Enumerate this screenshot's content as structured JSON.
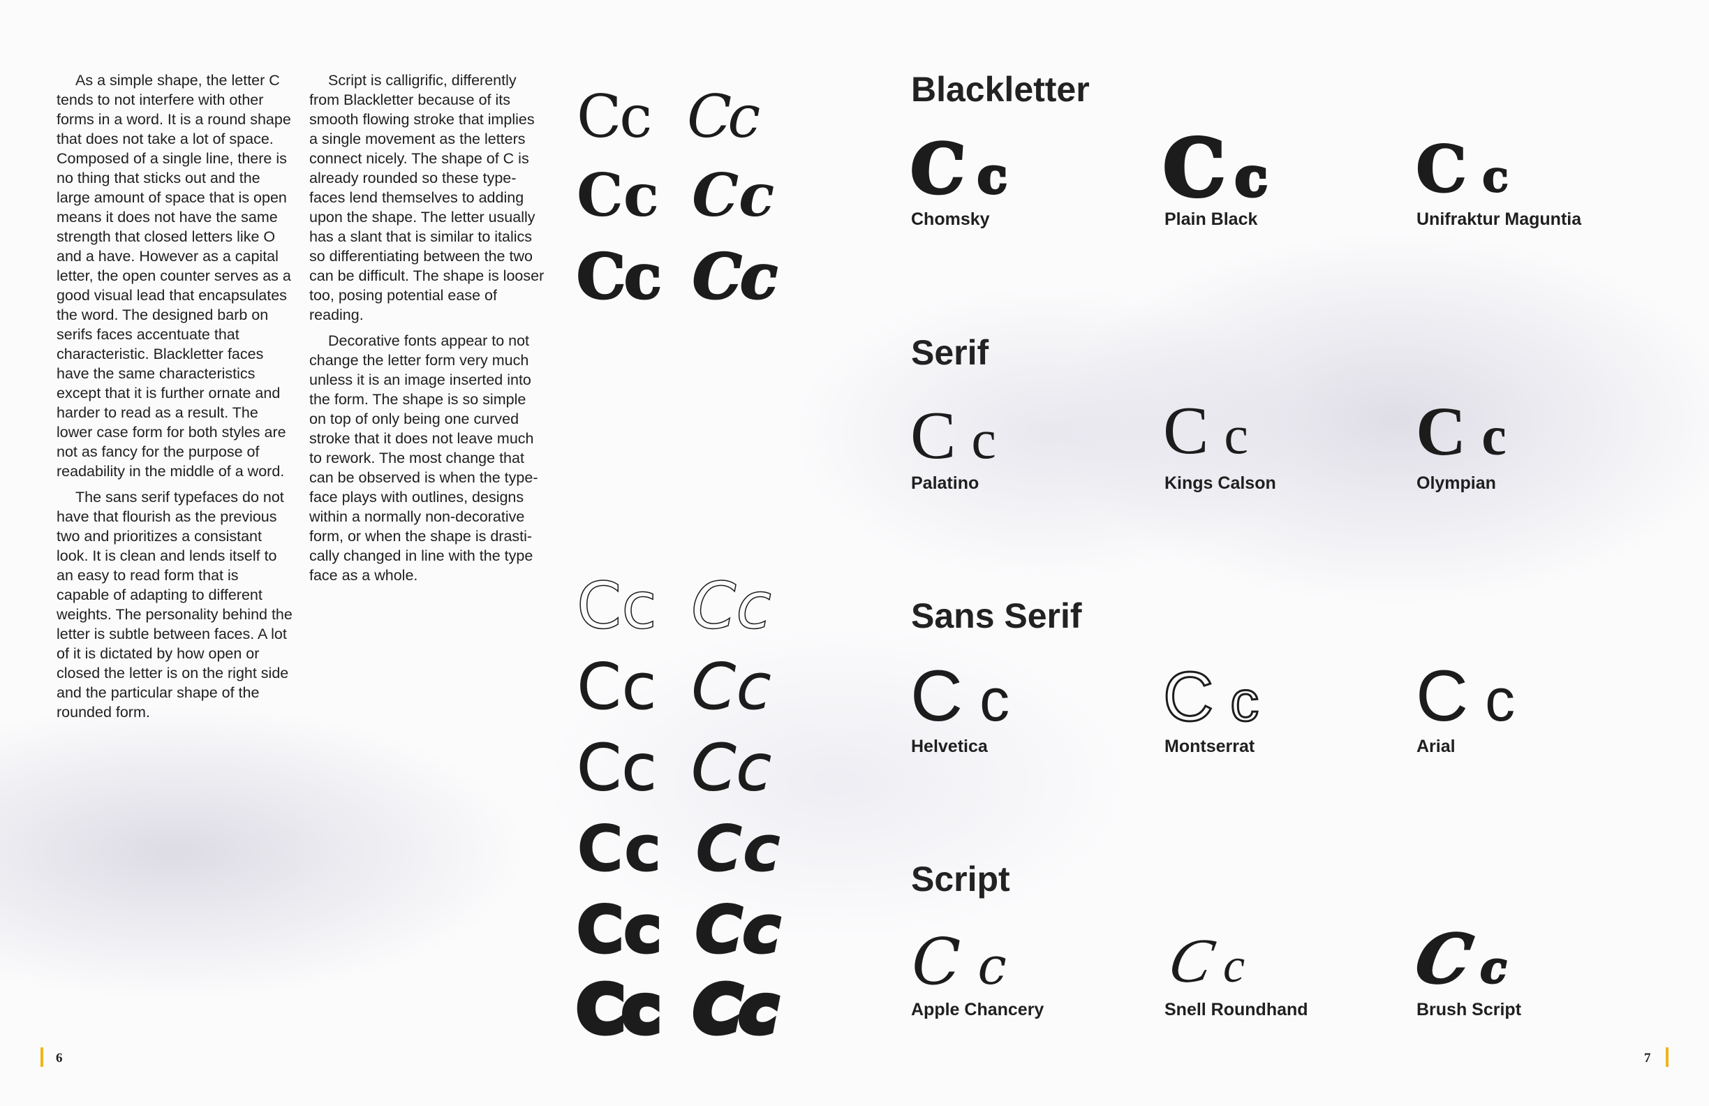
{
  "column_left": {
    "paragraphs": [
      "As a simple shape, the letter C tends to not interfere with other forms in a word. It is a round shape that  does not take a lot of space. Composed of a single line, there is no thing that sticks out and the large amount of space that is open means it does not have the same strength that closed letters like O and a have. However as a capital letter, the open counter serves as a good visual lead that encapsulates the word. The designed barb on serifs faces accentuate that characteristic. Blackletter faces have the same characteristics except that it is further ornate and harder to read as a result. The lower case form for both styles are not as fancy for the purpose of readability in the middle of a word.",
      "The sans serif typefaces do not have that flourish as the previous two and prioritizes a consistant look. It is clean and lends itself to an easy to read form that is capable of adapting to different weights. The personality behind the letter is subtle between faces. A lot of it is dictated by how open or closed the letter is on the right side and the particular shape of the rounded form."
    ]
  },
  "column_right": {
    "paragraphs": [
      "Script is calligrific, differently from Blackletter because of its smooth flowing stroke that implies a single movement as the letters connect nicely. The shape of C is already rounded so these type-faces lend themselves to adding upon the shape. The letter usually has a slant that is similar to italics so differentiating between the two can be difficult. The shape is looser too, posing potential ease of reading.",
      "Decorative fonts appear to not change the letter form very much unless it is an image inserted into the form. The shape is so simple on top of only being one curved stroke that it does not leave much to rework. The most change that can be observed is when the type-face plays with outlines, designs within a normally non-decorative form, or when the shape is drasti-cally changed in line with the type face as a whole."
    ]
  },
  "weight_samples": {
    "serif": [
      {
        "roman": "Cc",
        "italic": "Cc"
      },
      {
        "roman": "Cc",
        "italic": "Cc"
      },
      {
        "roman": "Cc",
        "italic": "Cc"
      }
    ],
    "sans": [
      {
        "roman": "Cc",
        "italic": "Cc"
      },
      {
        "roman": "Cc",
        "italic": "Cc"
      },
      {
        "roman": "Cc",
        "italic": "Cc"
      },
      {
        "roman": "Cc",
        "italic": "Cc"
      },
      {
        "roman": "Cc",
        "italic": "Cc"
      },
      {
        "roman": "Cc",
        "italic": "Cc"
      }
    ]
  },
  "categories": [
    {
      "title": "Blackletter",
      "fonts": [
        {
          "glyph_upper": "C",
          "glyph_lower": "c",
          "name": "Chomsky"
        },
        {
          "glyph_upper": "C",
          "glyph_lower": "c",
          "name": "Plain Black"
        },
        {
          "glyph_upper": "C",
          "glyph_lower": "c",
          "name": "Unifraktur Maguntia"
        }
      ]
    },
    {
      "title": "Serif",
      "fonts": [
        {
          "glyph_upper": "C",
          "glyph_lower": "c",
          "name": "Palatino"
        },
        {
          "glyph_upper": "C",
          "glyph_lower": "c",
          "name": "Kings Calson"
        },
        {
          "glyph_upper": "C",
          "glyph_lower": "c",
          "name": "Olympian"
        }
      ]
    },
    {
      "title": "Sans Serif",
      "fonts": [
        {
          "glyph_upper": "C",
          "glyph_lower": "c",
          "name": "Helvetica"
        },
        {
          "glyph_upper": "C",
          "glyph_lower": "c",
          "name": "Montserrat"
        },
        {
          "glyph_upper": "C",
          "glyph_lower": "c",
          "name": "Arial"
        }
      ]
    },
    {
      "title": "Script",
      "fonts": [
        {
          "glyph_upper": "C",
          "glyph_lower": "c",
          "name": "Apple Chancery"
        },
        {
          "glyph_upper": "C",
          "glyph_lower": "c",
          "name": "Snell Roundhand"
        },
        {
          "glyph_upper": "C",
          "glyph_lower": "c",
          "name": "Brush Script"
        }
      ]
    }
  ],
  "folio": {
    "left": "6",
    "right": "7",
    "accent_color": "#f0b41c"
  }
}
